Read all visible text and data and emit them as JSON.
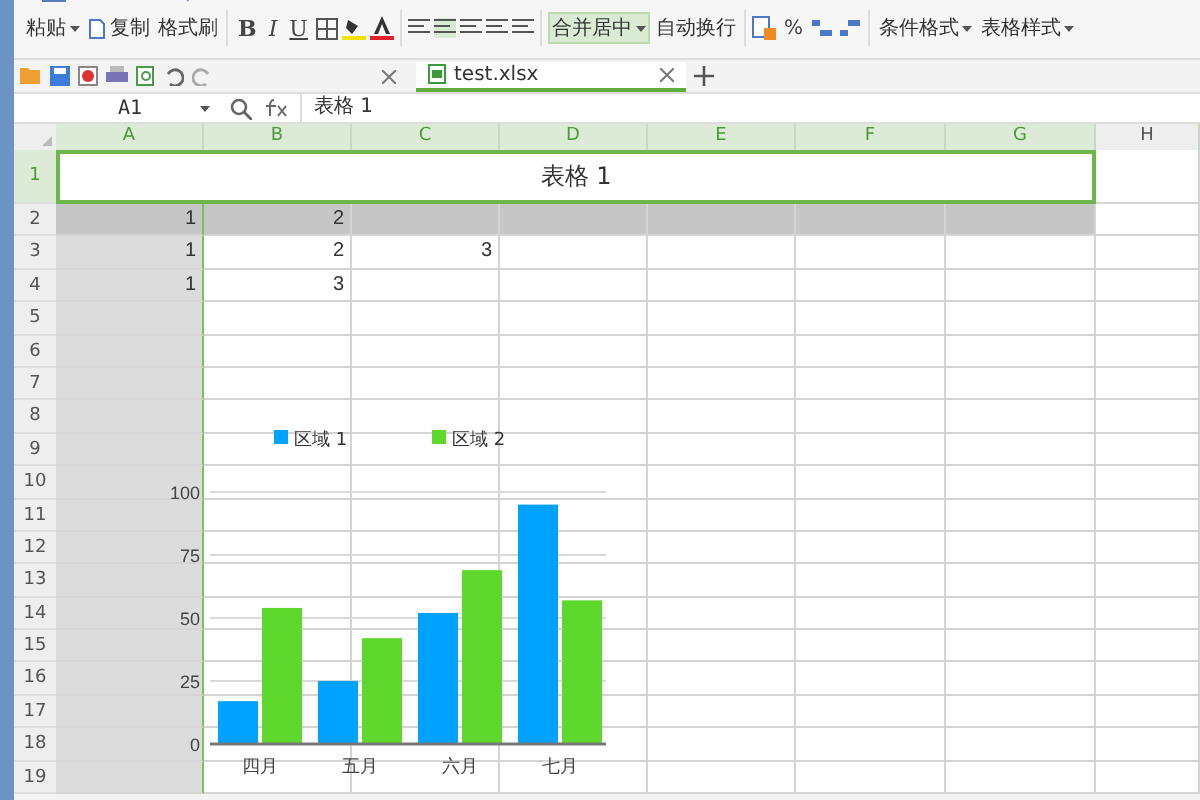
{
  "ribbon": {
    "clipboard": [
      {
        "label": "粘贴",
        "dropdown": true
      },
      {
        "label": "复制",
        "dropdown": false
      },
      {
        "label": "格式刷",
        "dropdown": false
      }
    ],
    "font_buttons": [
      "B",
      "I",
      "U"
    ],
    "merge": [
      {
        "label": "合并居中",
        "dropdown": true,
        "selected": true
      },
      {
        "label": "自动换行",
        "dropdown": false,
        "selected": false
      }
    ],
    "number_buttons": [
      "%"
    ],
    "styles": [
      {
        "label": "条件格式",
        "dropdown": true
      },
      {
        "label": "表格样式",
        "dropdown": true
      }
    ]
  },
  "tabs": [
    {
      "label": "test.xlsx",
      "selected": true
    }
  ],
  "formula_bar": {
    "cell": "A1",
    "formula": "表格 1"
  },
  "sheet": {
    "columns": [
      {
        "label": "A",
        "selected": true
      },
      {
        "label": "B",
        "selected": true
      },
      {
        "label": "C",
        "selected": true
      },
      {
        "label": "D",
        "selected": true
      },
      {
        "label": "E",
        "selected": true
      },
      {
        "label": "F",
        "selected": true
      },
      {
        "label": "G",
        "selected": true
      },
      {
        "label": "H",
        "selected": false
      }
    ],
    "rows": [
      {
        "number": "1",
        "selected": true,
        "merged_title": "表格 1",
        "cells": {}
      },
      {
        "number": "2",
        "selected": false,
        "shaded": true,
        "cells": {
          "A": "1",
          "B": "2"
        }
      },
      {
        "number": "3",
        "selected": false,
        "shaded": false,
        "cells": {
          "A": "1",
          "B": "2",
          "C": "3"
        }
      },
      {
        "number": "4",
        "selected": false,
        "shaded": false,
        "cells": {
          "A": "1",
          "B": "3"
        }
      },
      {
        "number": "5",
        "selected": false,
        "shaded": false,
        "cells": {}
      },
      {
        "number": "6",
        "selected": false,
        "shaded": false,
        "cells": {}
      },
      {
        "number": "7",
        "selected": false,
        "shaded": false,
        "cells": {}
      },
      {
        "number": "8",
        "selected": false,
        "shaded": false,
        "cells": {}
      },
      {
        "number": "9",
        "selected": false,
        "shaded": false,
        "cells": {}
      },
      {
        "number": "10",
        "selected": false,
        "shaded": false,
        "cells": {}
      },
      {
        "number": "11",
        "selected": false,
        "shaded": false,
        "cells": {}
      },
      {
        "number": "12",
        "selected": false,
        "shaded": false,
        "cells": {}
      },
      {
        "number": "13",
        "selected": false,
        "shaded": false,
        "cells": {}
      },
      {
        "number": "14",
        "selected": false,
        "shaded": false,
        "cells": {}
      },
      {
        "number": "15",
        "selected": false,
        "shaded": false,
        "cells": {}
      },
      {
        "number": "16",
        "selected": false,
        "shaded": false,
        "cells": {}
      },
      {
        "number": "17",
        "selected": false,
        "shaded": false,
        "cells": {}
      },
      {
        "number": "18",
        "selected": false,
        "shaded": false,
        "cells": {}
      },
      {
        "number": "19",
        "selected": false,
        "shaded": false,
        "cells": {}
      }
    ],
    "chart_data": {
      "type": "bar",
      "categories": [
        "四月",
        "五月",
        "六月",
        "七月"
      ],
      "series": [
        {
          "name": "区域 1",
          "color": "#00a2ff",
          "values": [
            17,
            25,
            52,
            95
          ]
        },
        {
          "name": "区域 2",
          "color": "#5fd82e",
          "values": [
            54,
            42,
            69,
            57
          ]
        }
      ],
      "ylim": [
        0,
        100
      ],
      "yticks": [
        0,
        25,
        50,
        75,
        100
      ],
      "grid": true,
      "legend": true
    }
  }
}
